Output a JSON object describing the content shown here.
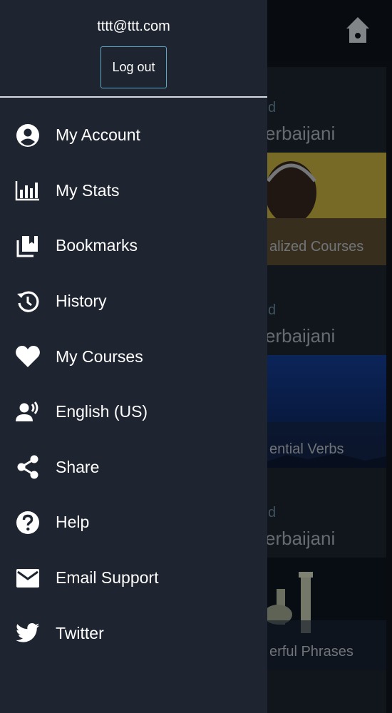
{
  "drawer": {
    "user_email": "tttt@ttt.com",
    "logout_label": "Log out",
    "menu": [
      {
        "label": "My Account",
        "icon": "account-circle-icon"
      },
      {
        "label": "My Stats",
        "icon": "bar-chart-icon"
      },
      {
        "label": "Bookmarks",
        "icon": "bookmarks-icon"
      },
      {
        "label": "History",
        "icon": "history-icon"
      },
      {
        "label": "My Courses",
        "icon": "heart-icon"
      },
      {
        "label": "English (US)",
        "icon": "voice-language-icon"
      },
      {
        "label": "Share",
        "icon": "share-icon"
      },
      {
        "label": "Help",
        "icon": "help-icon"
      },
      {
        "label": "Email Support",
        "icon": "email-icon"
      },
      {
        "label": "Twitter",
        "icon": "twitter-icon"
      }
    ]
  },
  "background": {
    "cards": [
      {
        "tag": "d",
        "language": "erbaijani",
        "caption": "alized Courses"
      },
      {
        "tag": "d",
        "language": "erbaijani",
        "caption": "ential Verbs"
      },
      {
        "tag": "d",
        "language": "erbaijani",
        "caption": "erful Phrases"
      }
    ]
  },
  "colors": {
    "drawer_bg": "#1e2430",
    "accent_border": "#5fa8c7",
    "text": "#ffffff"
  }
}
